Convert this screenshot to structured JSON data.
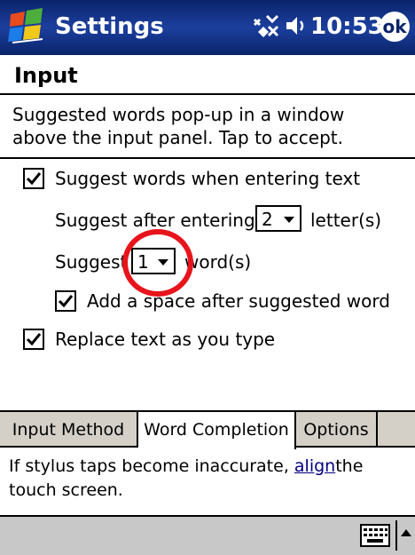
{
  "titlebar": {
    "app_title": "Settings",
    "clock": "10:53",
    "ok_label": "ok"
  },
  "page": {
    "header": "Input",
    "description": "Suggested words pop-up in a window above the input panel.  Tap to accept."
  },
  "options": {
    "suggest_words": {
      "label": "Suggest words when entering text",
      "checked": true
    },
    "suggest_after": {
      "prefix": "Suggest after entering",
      "value": "2",
      "suffix": "letter(s)"
    },
    "suggest_count": {
      "prefix": "Suggest",
      "value": "1",
      "suffix": "word(s)"
    },
    "add_space": {
      "label": "Add a space after suggested word",
      "checked": true
    },
    "replace_text": {
      "label": "Replace text as you type",
      "checked": true
    }
  },
  "tabs": [
    {
      "label": "Input Method",
      "active": false
    },
    {
      "label": "Word Completion",
      "active": true
    },
    {
      "label": "Options",
      "active": false
    }
  ],
  "footer": {
    "text_before": "If stylus taps become inaccurate, ",
    "link": "align",
    "text_after": "the touch screen."
  },
  "colors": {
    "titlebar": "#0a246a",
    "highlight_circle": "#e8141c",
    "menubar": "#c8c8c8"
  },
  "icons": [
    "windows-start-icon",
    "connectivity-icon",
    "volume-icon",
    "ok-icon",
    "keyboard-icon",
    "sip-arrow-icon"
  ]
}
